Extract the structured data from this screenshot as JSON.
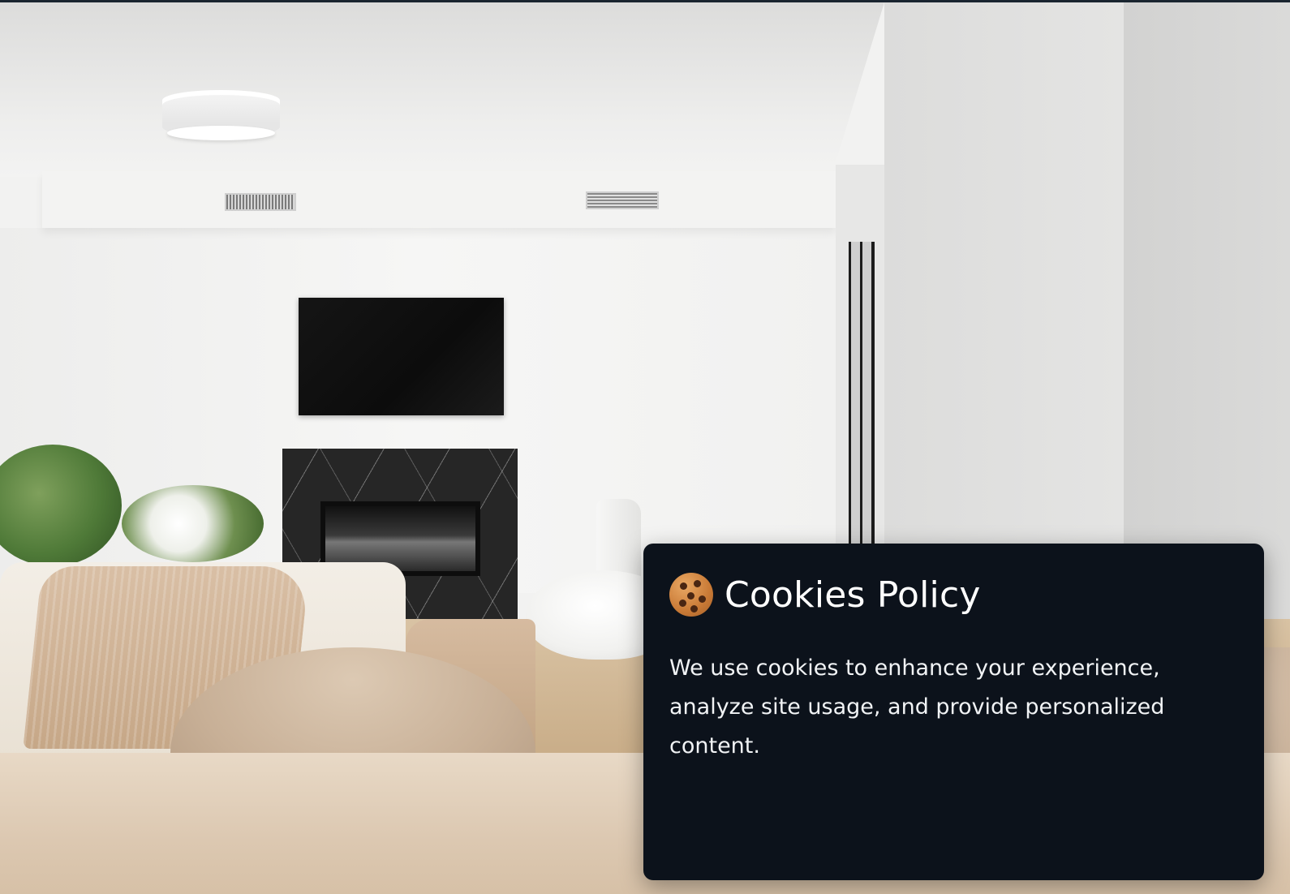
{
  "background": {
    "description_icon": "living-room-photo"
  },
  "cookie_banner": {
    "icon": "cookie-icon",
    "title": "Cookies Policy",
    "message": "We use cookies to enhance your experience, analyze site usage, and provide personalized content."
  },
  "colors": {
    "panel_background": "#0c121b",
    "panel_text": "#ffffff"
  }
}
